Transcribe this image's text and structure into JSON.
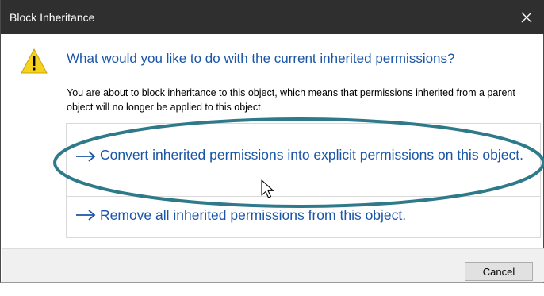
{
  "window": {
    "title": "Block Inheritance",
    "close_icon": "close-icon"
  },
  "prompt": {
    "icon": "warning-icon",
    "heading": "What would you like to do with the current inherited permissions?",
    "description": "You are about to block inheritance to this object, which means that permissions inherited from a parent object will no longer be applied to this object."
  },
  "options": [
    {
      "icon": "arrow-right-icon",
      "label": "Convert inherited permissions into explicit permissions on this object."
    },
    {
      "icon": "arrow-right-icon",
      "label": "Remove all inherited permissions from this object."
    }
  ],
  "footer": {
    "cancel_label": "Cancel"
  },
  "annotation": {
    "highlight_color": "#2e7a8a",
    "shape": "ellipse"
  },
  "colors": {
    "titlebar": "#2f2f2f",
    "link": "#1a55a8",
    "warning_fill": "#f6d21f"
  }
}
